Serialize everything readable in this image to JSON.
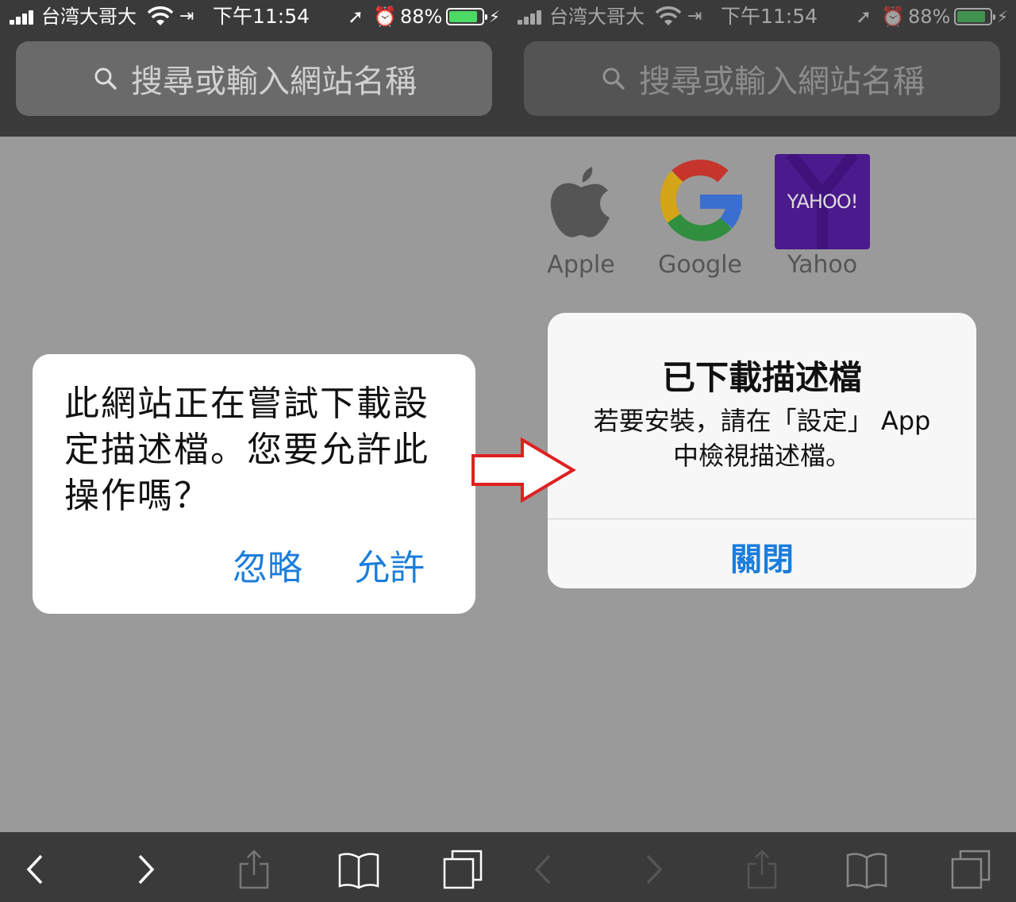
{
  "status": {
    "carrier": "台湾大哥大",
    "time": "下午11:54",
    "battery_pct": "88%",
    "battery_level": 0.88
  },
  "urlbar": {
    "placeholder": "搜尋或輸入網站名稱"
  },
  "left_alert": {
    "message": "此網站正在嘗試下載設定描述檔。您要允許此操作嗎？",
    "ignore_label": "忽略",
    "allow_label": "允許"
  },
  "right_alert": {
    "title": "已下載描述檔",
    "body": "若要安裝，請在「設定」 App 中檢視描述檔。",
    "close_label": "關閉"
  },
  "favorites": [
    {
      "label": "Apple",
      "icon": "apple-logo-icon"
    },
    {
      "label": "Google",
      "icon": "google-logo-icon"
    },
    {
      "label": "Yahoo",
      "icon": "yahoo-logo-icon",
      "logo_text": "YAHOO!"
    }
  ],
  "colors": {
    "link": "#1b7ddb",
    "bars": "#3a3a3a",
    "yahoo": "#4b0f95",
    "battery": "#4cd964",
    "arrow": "#e02020"
  }
}
